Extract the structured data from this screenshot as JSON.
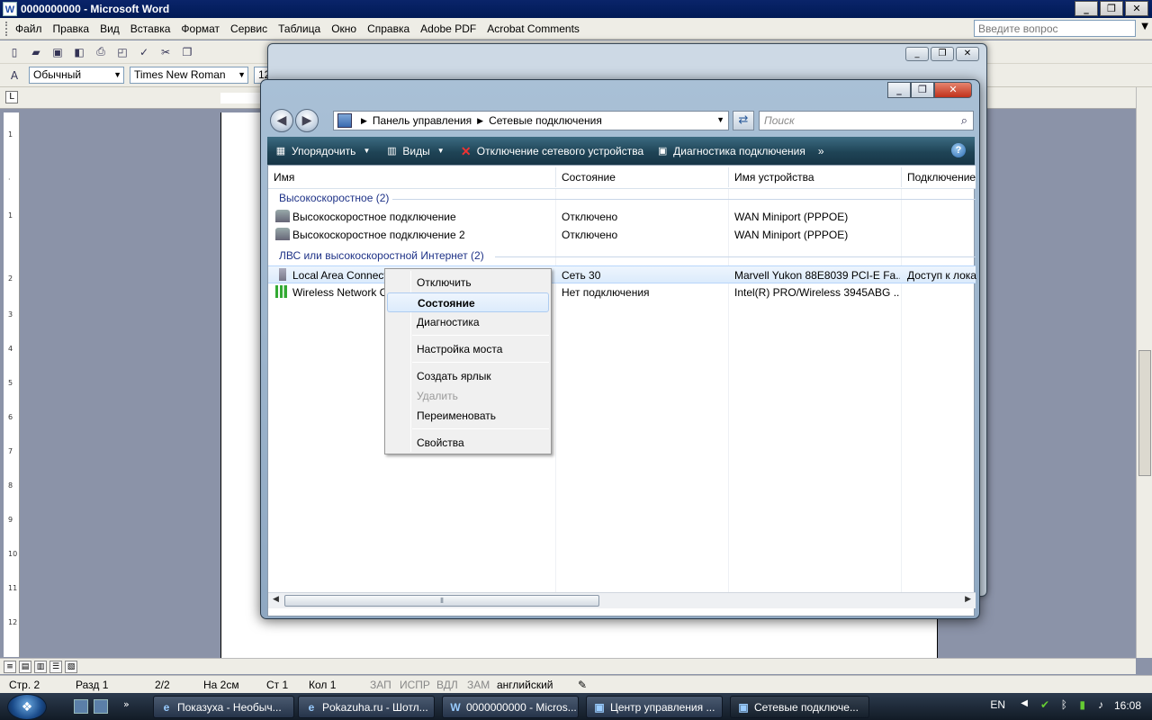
{
  "word": {
    "title": "0000000000 - Microsoft Word",
    "menu": [
      "Файл",
      "Правка",
      "Вид",
      "Вставка",
      "Формат",
      "Сервис",
      "Таблица",
      "Окно",
      "Справка",
      "Adobe PDF",
      "Acrobat Comments"
    ],
    "ask_placeholder": "Введите вопрос",
    "style_value": "Обычный",
    "font_value": "Times New Roman",
    "size_value": "12",
    "status": {
      "page": "Стр. 2",
      "section": "Разд 1",
      "pages": "2/2",
      "at": "На  2см",
      "line": "Ст  1",
      "col": "Кол  1",
      "rec": "ЗАП",
      "trk": "ИСПР",
      "ext": "ВДЛ",
      "ovr": "ЗАМ",
      "lang": "английский"
    }
  },
  "explorer": {
    "breadcrumb": [
      "Панель управления",
      "Сетевые подключения"
    ],
    "search_placeholder": "Поиск",
    "commands": [
      "Упорядочить",
      "Виды",
      "Отключение сетевого устройства",
      "Диагностика подключения"
    ],
    "more": "»",
    "help": "?",
    "columns": [
      "Имя",
      "Состояние",
      "Имя устройства",
      "Подключение"
    ],
    "groups": [
      {
        "title": "Высокоскоростное (2)",
        "items": [
          {
            "name": "Высокоскоростное подключение",
            "state": "Отключено",
            "device": "WAN Miniport (PPPOE)",
            "conn": ""
          },
          {
            "name": "Высокоскоростное подключение 2",
            "state": "Отключено",
            "device": "WAN Miniport (PPPOE)",
            "conn": ""
          }
        ]
      },
      {
        "title": "ЛВС или высокоскоростной Интернет (2)",
        "items": [
          {
            "name": "Local Area Connect",
            "state": "Сеть  30",
            "device": "Marvell Yukon 88E8039 PCI-E Fa...",
            "conn": "Доступ к лока"
          },
          {
            "name": "Wireless Network Co",
            "state": "Нет подключения",
            "device": "Intel(R) PRO/Wireless 3945ABG ...",
            "conn": ""
          }
        ]
      }
    ]
  },
  "context_menu": {
    "items": [
      "Отключить",
      "Состояние",
      "Диагностика",
      "Настройка моста",
      "Создать ярлык",
      "Удалить",
      "Переименовать",
      "Свойства"
    ],
    "highlighted": "Состояние",
    "disabled": "Удалить"
  },
  "taskbar": {
    "tasks": [
      "Показуха - Необыч...",
      "Pokazuha.ru - Шотл...",
      "0000000000 - Micros...",
      "Центр управления ...",
      "Сетевые подключе..."
    ],
    "lang": "EN",
    "clock": "16:08"
  }
}
